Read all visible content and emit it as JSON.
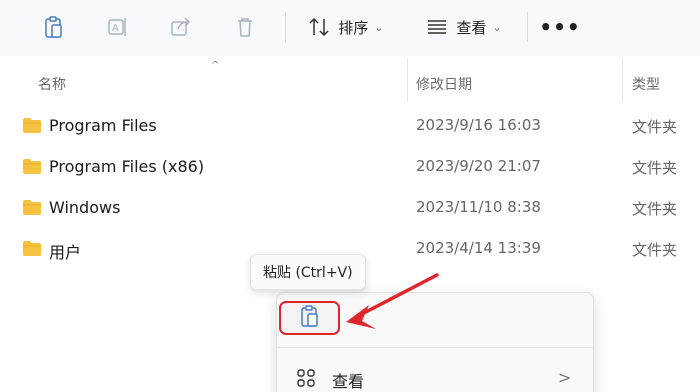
{
  "toolbar": {
    "sort_label": "排序",
    "view_label": "查看",
    "more_label": "•••"
  },
  "columns": {
    "name": "名称",
    "date": "修改日期",
    "type": "类型"
  },
  "rows": [
    {
      "name": "Program Files",
      "date": "2023/9/16 16:03",
      "type": "文件夹"
    },
    {
      "name": "Program Files (x86)",
      "date": "2023/9/20 21:07",
      "type": "文件夹"
    },
    {
      "name": "Windows",
      "date": "2023/11/10 8:38",
      "type": "文件夹"
    },
    {
      "name": "用户",
      "date": "2023/4/14 13:39",
      "type": "文件夹"
    }
  ],
  "tooltip": {
    "text": "粘贴 (Ctrl+V)"
  },
  "context_menu": {
    "view_label": "查看",
    "submenu_arrow": ">"
  },
  "colors": {
    "folder": "#f5c242",
    "highlight": "#e0262d",
    "arrow": "#e0262d"
  }
}
